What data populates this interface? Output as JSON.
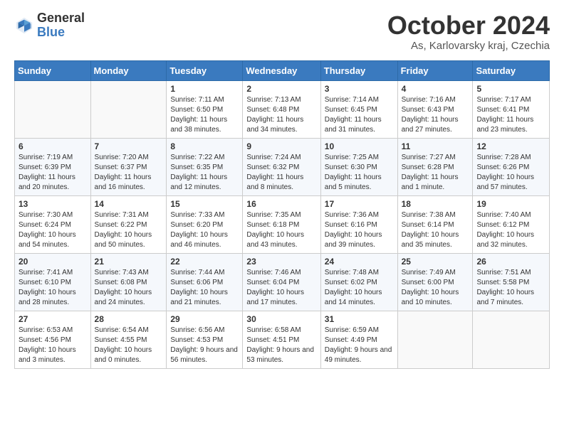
{
  "logo": {
    "general": "General",
    "blue": "Blue"
  },
  "title": "October 2024",
  "location": "As, Karlovarsky kraj, Czechia",
  "weekdays": [
    "Sunday",
    "Monday",
    "Tuesday",
    "Wednesday",
    "Thursday",
    "Friday",
    "Saturday"
  ],
  "weeks": [
    [
      {
        "day": "",
        "info": ""
      },
      {
        "day": "",
        "info": ""
      },
      {
        "day": "1",
        "info": "Sunrise: 7:11 AM\nSunset: 6:50 PM\nDaylight: 11 hours and 38 minutes."
      },
      {
        "day": "2",
        "info": "Sunrise: 7:13 AM\nSunset: 6:48 PM\nDaylight: 11 hours and 34 minutes."
      },
      {
        "day": "3",
        "info": "Sunrise: 7:14 AM\nSunset: 6:45 PM\nDaylight: 11 hours and 31 minutes."
      },
      {
        "day": "4",
        "info": "Sunrise: 7:16 AM\nSunset: 6:43 PM\nDaylight: 11 hours and 27 minutes."
      },
      {
        "day": "5",
        "info": "Sunrise: 7:17 AM\nSunset: 6:41 PM\nDaylight: 11 hours and 23 minutes."
      }
    ],
    [
      {
        "day": "6",
        "info": "Sunrise: 7:19 AM\nSunset: 6:39 PM\nDaylight: 11 hours and 20 minutes."
      },
      {
        "day": "7",
        "info": "Sunrise: 7:20 AM\nSunset: 6:37 PM\nDaylight: 11 hours and 16 minutes."
      },
      {
        "day": "8",
        "info": "Sunrise: 7:22 AM\nSunset: 6:35 PM\nDaylight: 11 hours and 12 minutes."
      },
      {
        "day": "9",
        "info": "Sunrise: 7:24 AM\nSunset: 6:32 PM\nDaylight: 11 hours and 8 minutes."
      },
      {
        "day": "10",
        "info": "Sunrise: 7:25 AM\nSunset: 6:30 PM\nDaylight: 11 hours and 5 minutes."
      },
      {
        "day": "11",
        "info": "Sunrise: 7:27 AM\nSunset: 6:28 PM\nDaylight: 11 hours and 1 minute."
      },
      {
        "day": "12",
        "info": "Sunrise: 7:28 AM\nSunset: 6:26 PM\nDaylight: 10 hours and 57 minutes."
      }
    ],
    [
      {
        "day": "13",
        "info": "Sunrise: 7:30 AM\nSunset: 6:24 PM\nDaylight: 10 hours and 54 minutes."
      },
      {
        "day": "14",
        "info": "Sunrise: 7:31 AM\nSunset: 6:22 PM\nDaylight: 10 hours and 50 minutes."
      },
      {
        "day": "15",
        "info": "Sunrise: 7:33 AM\nSunset: 6:20 PM\nDaylight: 10 hours and 46 minutes."
      },
      {
        "day": "16",
        "info": "Sunrise: 7:35 AM\nSunset: 6:18 PM\nDaylight: 10 hours and 43 minutes."
      },
      {
        "day": "17",
        "info": "Sunrise: 7:36 AM\nSunset: 6:16 PM\nDaylight: 10 hours and 39 minutes."
      },
      {
        "day": "18",
        "info": "Sunrise: 7:38 AM\nSunset: 6:14 PM\nDaylight: 10 hours and 35 minutes."
      },
      {
        "day": "19",
        "info": "Sunrise: 7:40 AM\nSunset: 6:12 PM\nDaylight: 10 hours and 32 minutes."
      }
    ],
    [
      {
        "day": "20",
        "info": "Sunrise: 7:41 AM\nSunset: 6:10 PM\nDaylight: 10 hours and 28 minutes."
      },
      {
        "day": "21",
        "info": "Sunrise: 7:43 AM\nSunset: 6:08 PM\nDaylight: 10 hours and 24 minutes."
      },
      {
        "day": "22",
        "info": "Sunrise: 7:44 AM\nSunset: 6:06 PM\nDaylight: 10 hours and 21 minutes."
      },
      {
        "day": "23",
        "info": "Sunrise: 7:46 AM\nSunset: 6:04 PM\nDaylight: 10 hours and 17 minutes."
      },
      {
        "day": "24",
        "info": "Sunrise: 7:48 AM\nSunset: 6:02 PM\nDaylight: 10 hours and 14 minutes."
      },
      {
        "day": "25",
        "info": "Sunrise: 7:49 AM\nSunset: 6:00 PM\nDaylight: 10 hours and 10 minutes."
      },
      {
        "day": "26",
        "info": "Sunrise: 7:51 AM\nSunset: 5:58 PM\nDaylight: 10 hours and 7 minutes."
      }
    ],
    [
      {
        "day": "27",
        "info": "Sunrise: 6:53 AM\nSunset: 4:56 PM\nDaylight: 10 hours and 3 minutes."
      },
      {
        "day": "28",
        "info": "Sunrise: 6:54 AM\nSunset: 4:55 PM\nDaylight: 10 hours and 0 minutes."
      },
      {
        "day": "29",
        "info": "Sunrise: 6:56 AM\nSunset: 4:53 PM\nDaylight: 9 hours and 56 minutes."
      },
      {
        "day": "30",
        "info": "Sunrise: 6:58 AM\nSunset: 4:51 PM\nDaylight: 9 hours and 53 minutes."
      },
      {
        "day": "31",
        "info": "Sunrise: 6:59 AM\nSunset: 4:49 PM\nDaylight: 9 hours and 49 minutes."
      },
      {
        "day": "",
        "info": ""
      },
      {
        "day": "",
        "info": ""
      }
    ]
  ]
}
